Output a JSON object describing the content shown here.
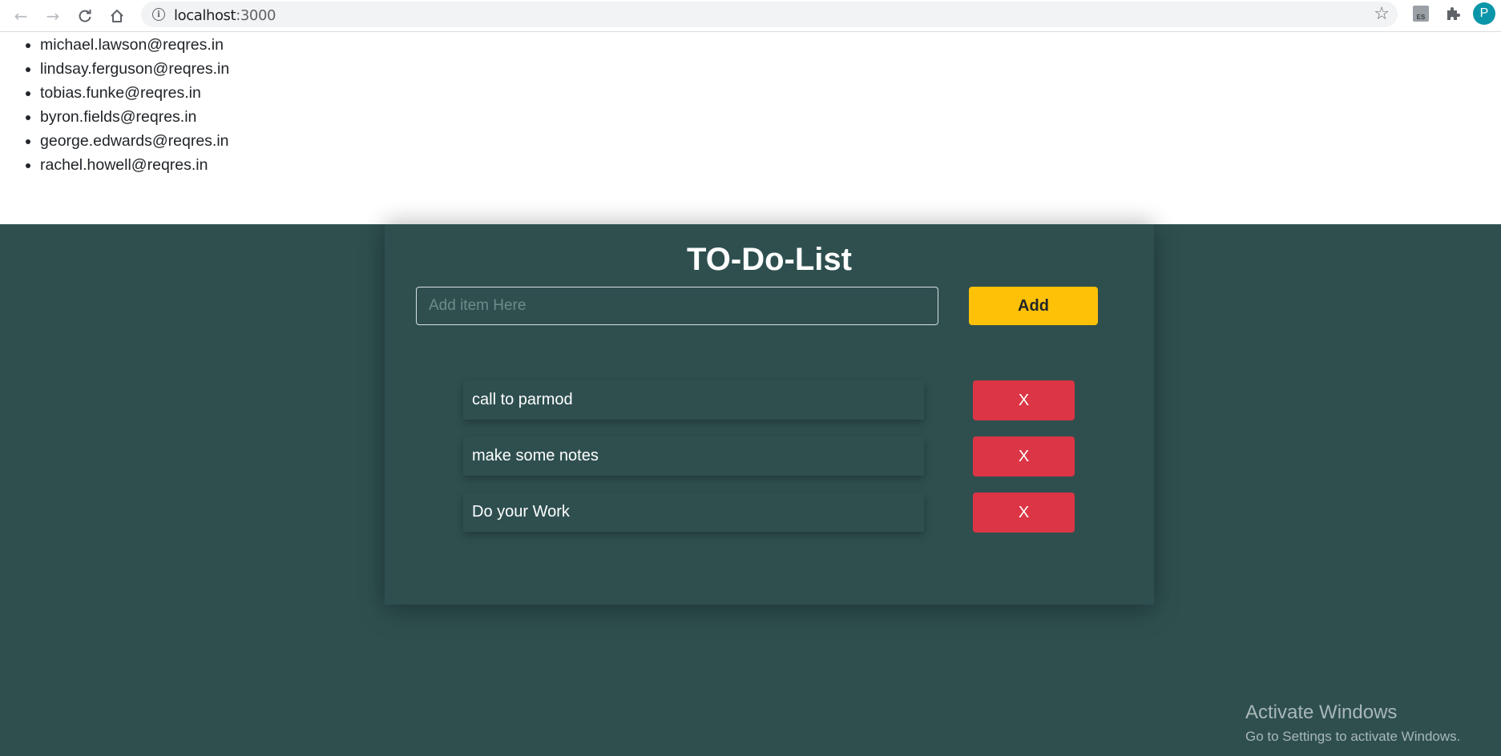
{
  "browser": {
    "url_host": "localhost",
    "url_port": ":3000",
    "extension_badge": "ES",
    "profile_initial": "P"
  },
  "emails": [
    "michael.lawson@reqres.in",
    "lindsay.ferguson@reqres.in",
    "tobias.funke@reqres.in",
    "byron.fields@reqres.in",
    "george.edwards@reqres.in",
    "rachel.howell@reqres.in"
  ],
  "todo": {
    "title": "TO-Do-List",
    "input_placeholder": "Add item Here",
    "input_value": "",
    "add_label": "Add",
    "items": [
      {
        "text": "call to parmod",
        "delete_label": "X"
      },
      {
        "text": "make some notes",
        "delete_label": "X"
      },
      {
        "text": "Do your Work",
        "delete_label": "X"
      }
    ]
  },
  "watermark": {
    "heading": "Activate Windows",
    "subtext": "Go to Settings to activate Windows."
  },
  "colors": {
    "background_teal": "#2f4f4f",
    "add_button": "#ffc107",
    "delete_button": "#dc3545"
  }
}
